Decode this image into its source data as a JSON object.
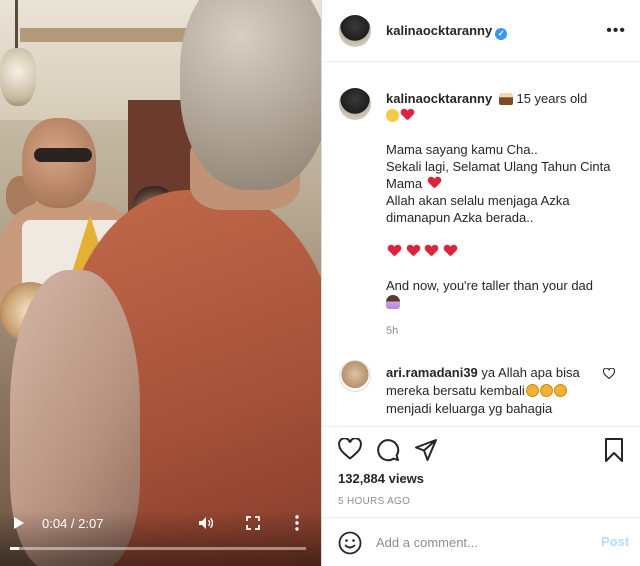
{
  "video": {
    "time": "0:04 / 2:07",
    "progress": 0.03
  },
  "header": {
    "username": "kalinaocktaranny",
    "verified_badge": "✓",
    "more": "•••"
  },
  "caption": {
    "username": "kalinaocktaranny",
    "headline": "15 years old",
    "lines": [
      "Mama sayang kamu Cha..",
      "Sekali lagi, Selamat Ulang Tahun Cinta",
      "Mama",
      "Allah akan selalu menjaga Azka",
      "dimanapun Azka berada..",
      "And now, you're taller than your dad"
    ],
    "time_ago": "5h"
  },
  "comment": {
    "username": "ari.ramadani39",
    "text_1": "ya Allah apa bisa",
    "text_2": "mereka bersatu kembali",
    "text_3": "menjadi keluarga yg bahagia"
  },
  "stats": {
    "views": "132,884 views",
    "posted": "5 HOURS AGO"
  },
  "composer": {
    "placeholder": "Add a comment...",
    "post_label": "Post"
  },
  "colors": {
    "accent": "#3897f0",
    "heart": "#d7263d",
    "post_disabled": "#b2dffc"
  },
  "icons": [
    "play-icon",
    "volume-icon",
    "fullscreen-icon",
    "more-vertical-icon",
    "verified-icon",
    "more-horizontal-icon",
    "heart-outline-icon",
    "comment-icon",
    "share-icon",
    "bookmark-icon",
    "emoji-icon"
  ]
}
